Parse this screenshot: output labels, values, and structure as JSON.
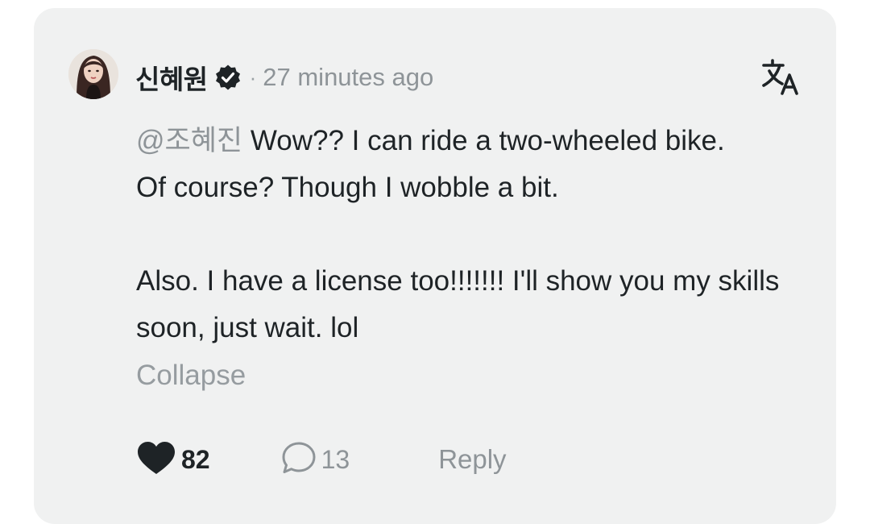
{
  "comment": {
    "author": "신혜원",
    "separator": "·",
    "time": "27 minutes ago",
    "mention": "@조혜진",
    "line1_text": " Wow?? I can ride a two-wheeled bike.",
    "line2_text": "Of course? Though I wobble a bit.",
    "paragraph2": "Also. I have a license too!!!!!!! I'll show you my skills soon, just wait. lol",
    "collapse_label": "Collapse"
  },
  "actions": {
    "like_count": "82",
    "comment_count": "13",
    "reply_label": "Reply"
  },
  "icons": {
    "verified": "verified-badge-icon",
    "translate": "translate-icon",
    "like": "heart-icon",
    "comment": "comment-bubble-icon"
  },
  "colors": {
    "card_background": "#f0f1f1",
    "primary_text": "#1e2326",
    "secondary_text": "#8e9498"
  }
}
